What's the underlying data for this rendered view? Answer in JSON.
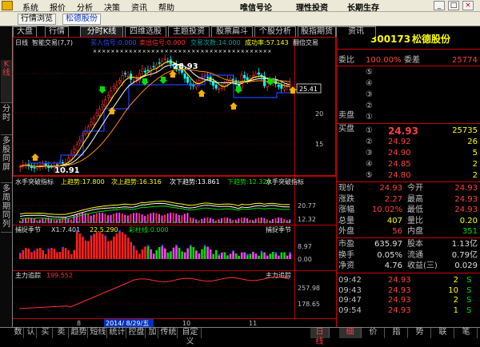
{
  "menubar": {
    "items": [
      "系统",
      "报价",
      "分析",
      "决策",
      "资讯",
      "帮助"
    ],
    "slogan": [
      "唯信号论",
      "理性投资",
      "长期生存"
    ],
    "window_buttons": [
      "_",
      "□",
      "×"
    ]
  },
  "tabbar": {
    "tabs": [
      "行情浏览",
      "松德股份"
    ]
  },
  "left_tabs": [
    "K线",
    "分时",
    "多股同屏",
    "多周期同列"
  ],
  "top_tabs": [
    "大盘",
    "行情",
    "分时K线",
    "四维选股",
    "主题投资",
    "股票扁斗",
    "个股分析",
    "股指期货",
    "资讯"
  ],
  "chart": {
    "header": {
      "period": "日线",
      "indicator": "智能交易(7,7)",
      "buy_signal": "买入信号:0.000",
      "sell_signal": "卖出信号:0.000",
      "trade_count": "交易次数:14.000",
      "success_rate": "成功率:57.143",
      "extra": "翻倍交易"
    },
    "price_max_label": "28.93",
    "price_min_label": "10.91",
    "current_label": "25.41",
    "price_axis": [
      "20",
      "15"
    ],
    "sub1": {
      "title": "水手突破指标",
      "up": "上趋势:17.800",
      "mid_up": "次上趋势:16.316",
      "mid_down": "次下趋势:13.861",
      "down": "下趋势:12.320",
      "name": "水手突破指标",
      "axis": [
        "20.77",
        "12.32"
      ]
    },
    "sub2": {
      "title": "捕捉季节",
      "x1": "X1:7.401",
      "val2": "22.5.290",
      "color_label": "彩柱线:0.000",
      "name": "捕捉季节",
      "axis": [
        "8.97",
        "0.00"
      ]
    },
    "sub3": {
      "title": "主力追踪",
      "value": "199.552",
      "name": "主力追踪",
      "axis": [
        "257.98",
        "178.65"
      ]
    },
    "date_axis": [
      "8",
      "2014/ 8/29/五",
      "10",
      "11"
    ],
    "colors": {
      "up": "#ff3030",
      "down": "#00ffff",
      "ma_yellow": "#ffff00",
      "ma_white": "#ffffff",
      "ma_blue": "#2040ff",
      "ma_orange": "#ff9000",
      "sub3_line": "#ff3030"
    }
  },
  "quote": {
    "code": "300173",
    "name": "松德股份",
    "weibi_label": "委比",
    "weibi": "100.00%",
    "weicha_label": "委差",
    "weicha": "25774",
    "sell_label": "卖盘",
    "buy_label": "买盘",
    "sell_rows": [
      "⑤",
      "④",
      "③",
      "②",
      "①"
    ],
    "buy_rows": [
      {
        "n": "①",
        "p": "24.93",
        "v": "25735"
      },
      {
        "n": "②",
        "p": "24.92",
        "v": "26"
      },
      {
        "n": "③",
        "p": "24.90",
        "v": "5"
      },
      {
        "n": "④",
        "p": "24.85",
        "v": "2"
      },
      {
        "n": "⑤",
        "p": "24.80",
        "v": "2"
      }
    ],
    "stats": [
      {
        "l1": "现价",
        "v1": "24.93",
        "l2": "今开",
        "v2": "24.93"
      },
      {
        "l1": "涨跌",
        "v1": "2.27",
        "l2": "最高",
        "v2": "24.93"
      },
      {
        "l1": "涨幅",
        "v1": "10.02%",
        "l2": "最低",
        "v2": "24.93"
      },
      {
        "l1": "总量",
        "v1": "407",
        "l2": "量比",
        "v2": "0.20"
      },
      {
        "l1": "外盘",
        "v1": "56",
        "l2": "内盘",
        "v2": "351"
      }
    ],
    "finance": [
      {
        "l1": "市盈",
        "v1": "635.97",
        "l2": "股本",
        "v2": "1.13亿"
      },
      {
        "l1": "换手",
        "v1": "0.05%",
        "l2": "流通",
        "v2": "0.79亿"
      },
      {
        "l1": "净资",
        "v1": "4.76",
        "l2": "收益(三)",
        "v2": "0.029"
      }
    ],
    "ticks": [
      {
        "t": "09:42",
        "p": "24.93",
        "v": "2",
        "d": "S"
      },
      {
        "t": "09:43",
        "p": "24.93",
        "v": "10",
        "d": "S"
      },
      {
        "t": "09:47",
        "p": "24.93",
        "v": "2",
        "d": "S"
      },
      {
        "t": "09:54",
        "p": "24.93",
        "v": "1",
        "d": "S"
      }
    ]
  },
  "bottom_tabs": [
    "数",
    "认",
    "买",
    "卖",
    "趋势",
    "短线",
    "统计",
    "控盘",
    "加",
    "传统",
    "自定义",
    "日 线"
  ],
  "bottom_right_tabs": [
    "细",
    "价",
    "指",
    "势",
    "联",
    "笔"
  ]
}
